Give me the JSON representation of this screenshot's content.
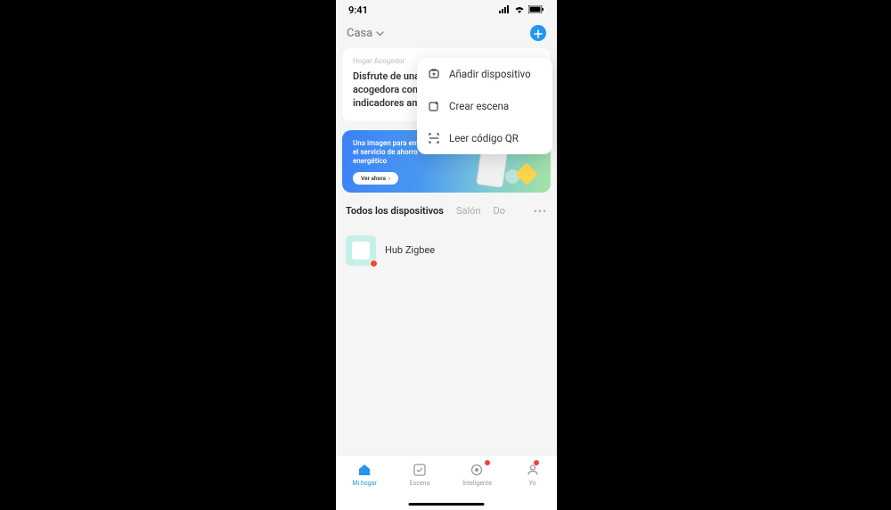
{
  "status": {
    "time": "9:41"
  },
  "header": {
    "home_label": "Casa"
  },
  "info_card": {
    "tag": "Hogar Acogedor",
    "line1": "Disfrute de una",
    "line2": "acogedora con",
    "line3": "indicadores am"
  },
  "dropdown": {
    "add_device": "Añadir dispositivo",
    "create_scene": "Crear escena",
    "scan_qr": "Leer código QR"
  },
  "banner": {
    "text": "Una imagen para entender el servicio de ahorro energético",
    "cta": "Ver ahora"
  },
  "tabs": {
    "all": "Todos los dispositivos",
    "room1": "Salón",
    "room2": "Do"
  },
  "device": {
    "name": "Hub Zigbee"
  },
  "nav": {
    "home": "Mi hogar",
    "scene": "Escena",
    "smart": "Inteligente",
    "me": "Yo"
  }
}
